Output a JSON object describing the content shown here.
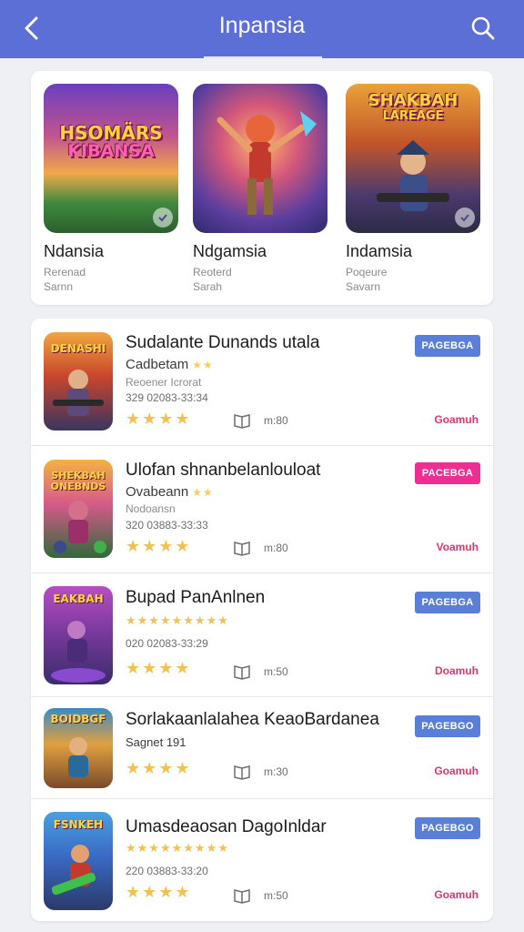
{
  "header": {
    "title": "Inpansia",
    "back_icon": "chevron-left-icon",
    "search_icon": "search-icon",
    "bg_color": "#5b6fd6"
  },
  "featured": [
    {
      "art_title": "HSOMÄRS",
      "art_subtitle": "KIBANSA",
      "name": "Ndansia",
      "line1": "Rerenad",
      "line2": "Sarnn"
    },
    {
      "art_title": "",
      "art_subtitle": "",
      "name": "Ndgamsia",
      "line1": "Reoterd",
      "line2": "Sarah"
    },
    {
      "art_title": "SHAKBAH",
      "art_subtitle": "LAREAGE",
      "name": "Indamsia",
      "line1": "Poqeure",
      "line2": "Savarn"
    }
  ],
  "list": [
    {
      "art_title": "DENASHI",
      "title": "Sudalante Dunands utala",
      "subtitle": "Cadbetam",
      "subtitle_stars": "★★",
      "developer": "Reoener Icrorat",
      "date": "329 02083-33:34",
      "stars": "★★★★",
      "size": "m:80",
      "button": "PAGEBGA",
      "button_color": "#5b7fd8",
      "link": "Goamuh"
    },
    {
      "art_title": "SHEKBAH ONEBNDS",
      "title": "Ulofan shnanbelanlouloat",
      "subtitle": "Ovabeann",
      "subtitle_stars": "★★",
      "developer": "Nodoansn",
      "date": "320 03883-33:33",
      "stars": "★★★★",
      "size": "m:80",
      "button": "PACEBGA",
      "button_color": "#ec2f93",
      "link": "Voamuh"
    },
    {
      "art_title": "EAKBAH",
      "title": "Bupad PanAnlnen",
      "tiny_stars": "★★★★★★★★★",
      "date": "020 02083-33:29",
      "stars": "★★★★",
      "size": "m:50",
      "button": "PAGEBGA",
      "button_color": "#5b7fd8",
      "link": "Doamuh"
    },
    {
      "art_title": "BOIDBGF",
      "title": "Sorlakaanlalahea KeaoBardanea",
      "subtitle": "Sagnet 191",
      "date": "",
      "stars": "★★★★",
      "size": "m:30",
      "button": "PAGEBGO",
      "button_color": "#5b7fd8",
      "link": "Goamuh"
    },
    {
      "art_title": "FSNKEH",
      "title": "Umasdeaosan DagoInldar",
      "tiny_stars": "★★★★★★★★★",
      "date": "220 03883-33:20",
      "stars": "★★★★",
      "size": "m:50",
      "button": "PAGEBGO",
      "button_color": "#5b7fd8",
      "link": "Goamuh"
    }
  ]
}
